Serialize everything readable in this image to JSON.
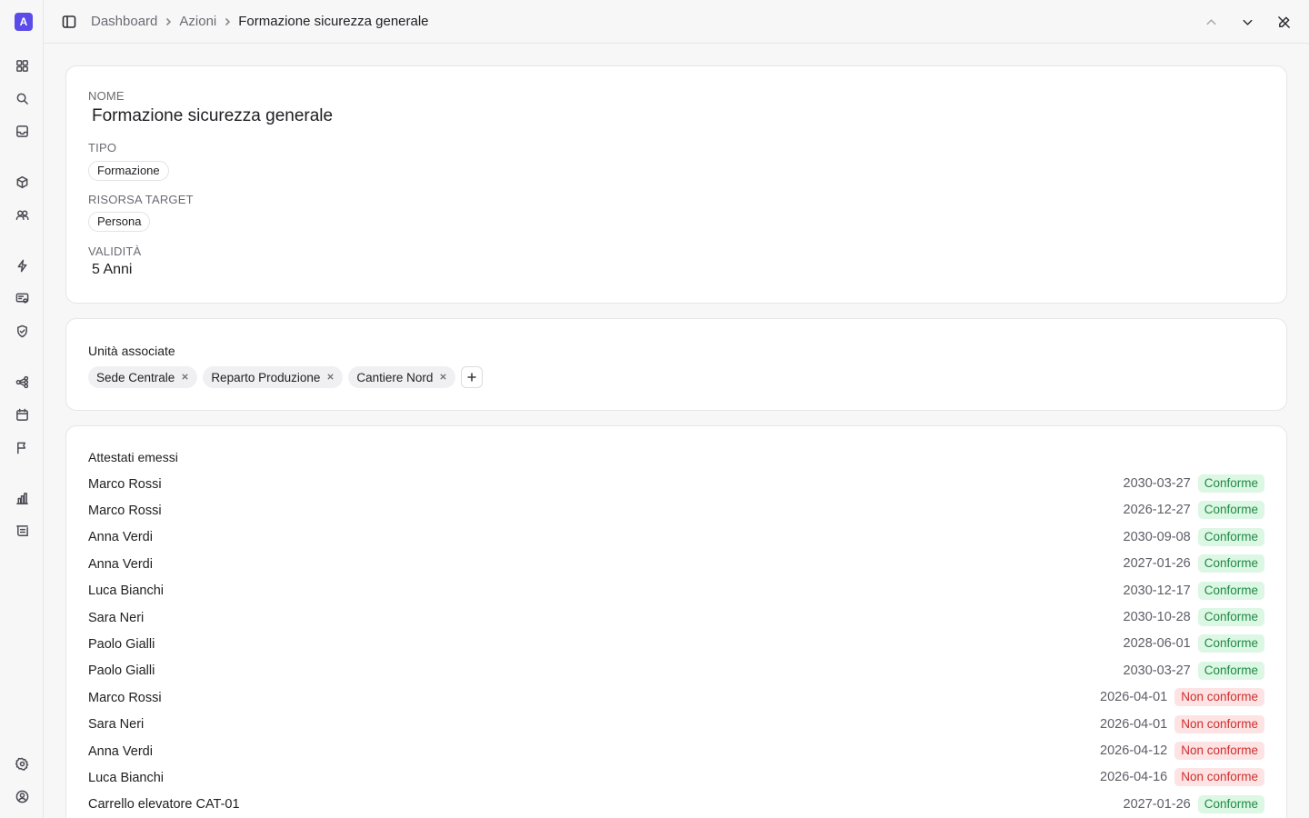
{
  "app": {
    "logo_letter": "A",
    "accent": "#5b4be8"
  },
  "sidebar": {
    "icons": [
      "grid-icon",
      "search-icon",
      "inbox-icon",
      "box-icon",
      "users-icon",
      "bolt-icon",
      "screen-icon",
      "shield-icon",
      "workflow-icon",
      "calendar-icon",
      "flag-icon",
      "chart-icon",
      "report-icon",
      "gear-icon",
      "user-circle-icon"
    ]
  },
  "breadcrumb": {
    "items": [
      "Dashboard",
      "Azioni"
    ],
    "current": "Formazione sicurezza generale"
  },
  "details": {
    "nome_label": "NOME",
    "nome_value": "Formazione sicurezza generale",
    "tipo_label": "TIPO",
    "tipo_value": "Formazione",
    "risorsa_label": "RISORSA TARGET",
    "risorsa_value": "Persona",
    "validita_label": "VALIDITÀ",
    "validita_value": "5 Anni"
  },
  "units": {
    "title": "Unità associate",
    "tags": [
      "Sede Centrale",
      "Reparto Produzione",
      "Cantiere Nord"
    ]
  },
  "certificates": {
    "title": "Attestati emessi",
    "status_colors": {
      "ok_bg": "#dcf7e3",
      "ok_text": "#1f8a45",
      "ko_bg": "#fde3e3",
      "ko_text": "#cf2e2e"
    },
    "rows": [
      {
        "name": "Marco Rossi",
        "date": "2030-03-27",
        "status": "Conforme",
        "ok": true
      },
      {
        "name": "Marco Rossi",
        "date": "2026-12-27",
        "status": "Conforme",
        "ok": true
      },
      {
        "name": "Anna Verdi",
        "date": "2030-09-08",
        "status": "Conforme",
        "ok": true
      },
      {
        "name": "Anna Verdi",
        "date": "2027-01-26",
        "status": "Conforme",
        "ok": true
      },
      {
        "name": "Luca Bianchi",
        "date": "2030-12-17",
        "status": "Conforme",
        "ok": true
      },
      {
        "name": "Sara Neri",
        "date": "2030-10-28",
        "status": "Conforme",
        "ok": true
      },
      {
        "name": "Paolo Gialli",
        "date": "2028-06-01",
        "status": "Conforme",
        "ok": true
      },
      {
        "name": "Paolo Gialli",
        "date": "2030-03-27",
        "status": "Conforme",
        "ok": true
      },
      {
        "name": "Marco Rossi",
        "date": "2026-04-01",
        "status": "Non conforme",
        "ok": false
      },
      {
        "name": "Sara Neri",
        "date": "2026-04-01",
        "status": "Non conforme",
        "ok": false
      },
      {
        "name": "Anna Verdi",
        "date": "2026-04-12",
        "status": "Non conforme",
        "ok": false
      },
      {
        "name": "Luca Bianchi",
        "date": "2026-04-16",
        "status": "Non conforme",
        "ok": false
      },
      {
        "name": "Carrello elevatore CAT-01",
        "date": "2027-01-26",
        "status": "Conforme",
        "ok": true
      }
    ]
  }
}
